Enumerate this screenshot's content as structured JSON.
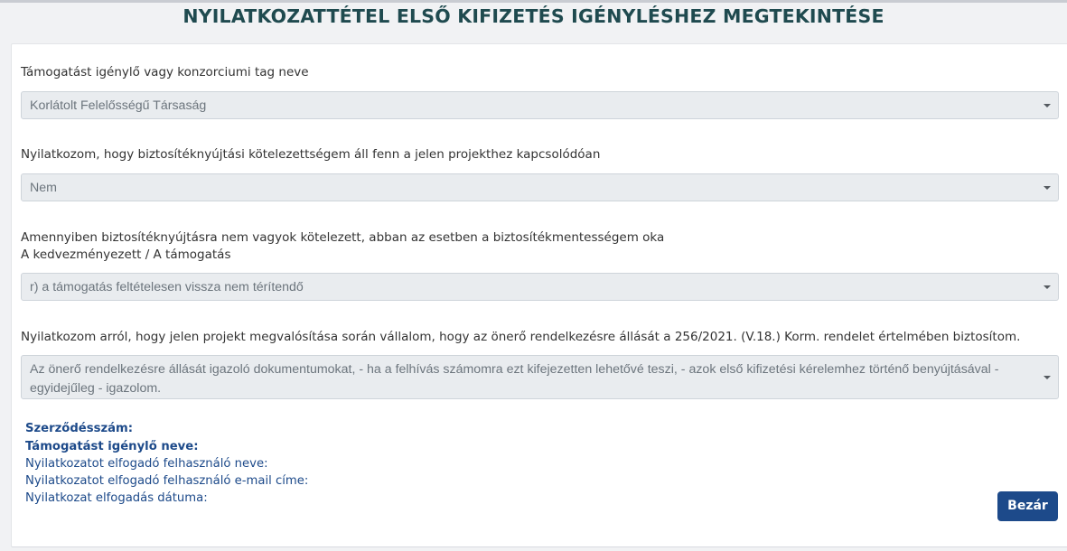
{
  "page_title": "NYILATKOZATTÉTEL ELSŐ KIFIZETÉS IGÉNYLÉSHEZ MEGTEKINTÉSE",
  "fields": [
    {
      "label": "Támogatást igénylő vagy konzorciumi tag neve",
      "value": "Korlátolt Felelősségű Társaság"
    },
    {
      "label": "Nyilatkozom, hogy biztosítéknyújtási kötelezettségem áll fenn a jelen projekthez kapcsolódóan",
      "value": "Nem"
    },
    {
      "label": "Amennyiben biztosítéknyújtásra nem vagyok kötelezett, abban az esetben a biztosítékmentességem oka",
      "label_line2": "A kedvezményezett / A támogatás",
      "value": "r) a támogatás feltételesen vissza nem térítendő"
    },
    {
      "label": "Nyilatkozom arról, hogy jelen projekt megvalósítása során vállalom, hogy az önerő rendelkezésre állását a 256/2021. (V.18.) Korm. rendelet értelmében biztosítom.",
      "value": "Az önerő rendelkezésre állását igazoló dokumentumokat, - ha a felhívás számomra ezt kifejezetten lehetővé teszi, - azok első kifizetési kérelemhez történő benyújtásával - egyidejűleg - igazolom."
    }
  ],
  "info": {
    "contract_number_label": "Szerződésszám:",
    "applicant_name_label": "Támogatást igénylő neve:",
    "accepting_user_name_label": "Nyilatkozatot elfogadó felhasználó neve:",
    "accepting_user_email_label": "Nyilatkozatot elfogadó felhasználó e-mail címe:",
    "acceptance_date_label": "Nyilatkozat elfogadás dátuma:"
  },
  "buttons": {
    "close_label": "Bezár"
  },
  "colors": {
    "title": "#1f4a4f",
    "info_text": "#1d4a8a",
    "button_bg": "#1d4a8a",
    "select_bg": "#e9ecef"
  },
  "icons": {
    "select_caret": "caret-down-icon"
  }
}
